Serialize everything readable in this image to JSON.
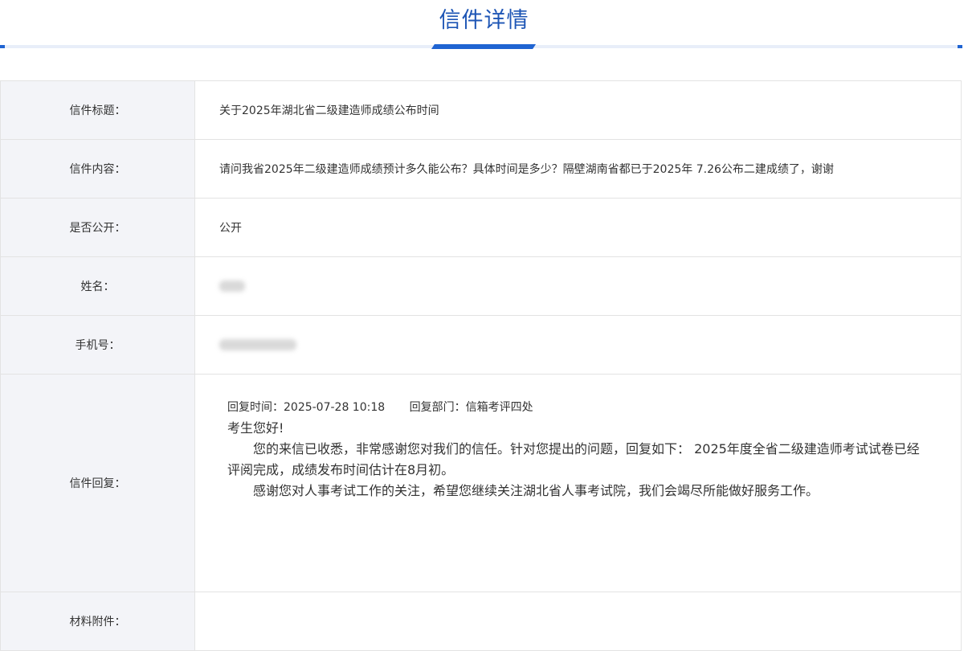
{
  "header": {
    "title": "信件详情"
  },
  "rows": {
    "title": {
      "label": "信件标题：",
      "value": "关于2025年湖北省二级建造师成绩公布时间"
    },
    "content": {
      "label": "信件内容：",
      "value": "请问我省2025年二级建造师成绩预计多久能公布？具体时间是多少？隔壁湖南省都已于2025年 7.26公布二建成绩了，谢谢"
    },
    "public": {
      "label": "是否公开：",
      "value": "公开"
    },
    "name": {
      "label": "姓名："
    },
    "phone": {
      "label": "手机号："
    },
    "reply": {
      "label": "信件回复：",
      "time": "回复时间：2025-07-28 10:18",
      "dept": "回复部门：信箱考评四处",
      "greeting": "考生您好!",
      "para1": "您的来信已收悉，非常感谢您对我们的信任。针对您提出的问题，回复如下：   2025年度全省二级建造师考试试卷已经评阅完成，成绩发布时间估计在8月初。",
      "para2": "感谢您对人事考试工作的关注，希望您继续关注湖北省人事考试院，我们会竭尽所能做好服务工作。"
    },
    "attachment": {
      "label": "材料附件："
    }
  }
}
